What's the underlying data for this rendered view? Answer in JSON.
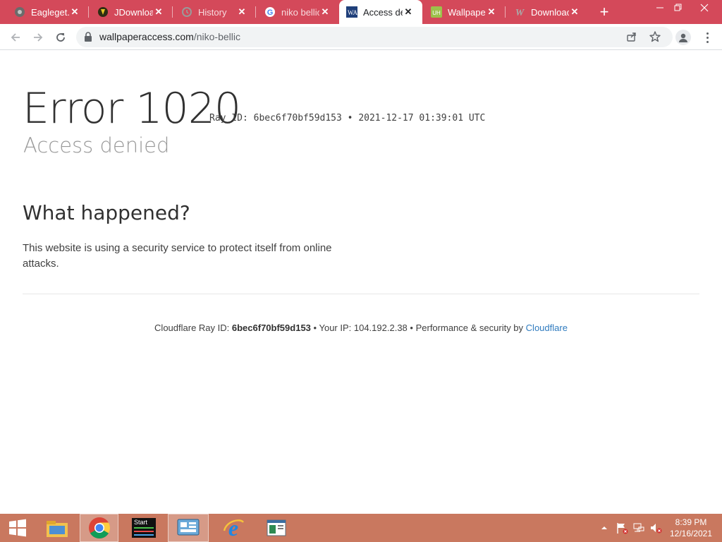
{
  "browser": {
    "tabs": [
      {
        "title": "Eagleget.c",
        "icon": "eagleget-icon",
        "active": false
      },
      {
        "title": "JDownloa",
        "icon": "jdownloader-icon",
        "active": false
      },
      {
        "title": "History",
        "icon": "history-icon",
        "active": false
      },
      {
        "title": "niko bellic",
        "icon": "google-icon",
        "active": false
      },
      {
        "title": "Access de",
        "icon": "wallpaperaccess-icon",
        "active": true
      },
      {
        "title": "Wallpaper",
        "icon": "wallpaper-icon",
        "active": false
      },
      {
        "title": "Downloac",
        "icon": "w-icon",
        "active": false
      }
    ],
    "url_domain": "wallpaperaccess.com",
    "url_path": "/niko-bellic",
    "tab_close_glyph": "✕",
    "new_tab_glyph": "+"
  },
  "page": {
    "error_title": "Error 1020",
    "ray_line": "Ray ID: 6bec6f70bf59d153 • 2021-12-17 01:39:01 UTC",
    "subtitle": "Access denied",
    "what_happened": "What happened?",
    "body": "This website is using a security service to protect itself from online attacks.",
    "footer": {
      "ray_label": "Cloudflare Ray ID:",
      "ray_id": "6bec6f70bf59d153",
      "sep1": "•",
      "ip_text": "Your IP: 104.192.2.38",
      "sep2": "•",
      "perf_text": "Performance & security by",
      "cloudflare_link": "Cloudflare"
    }
  },
  "taskbar": {
    "time": "8:39 PM",
    "date": "12/16/2021",
    "start_app_label": "Start"
  },
  "colors": {
    "tabstrip": "#d4495a",
    "taskbar": "#c9785f",
    "link": "#2f7bbf"
  }
}
